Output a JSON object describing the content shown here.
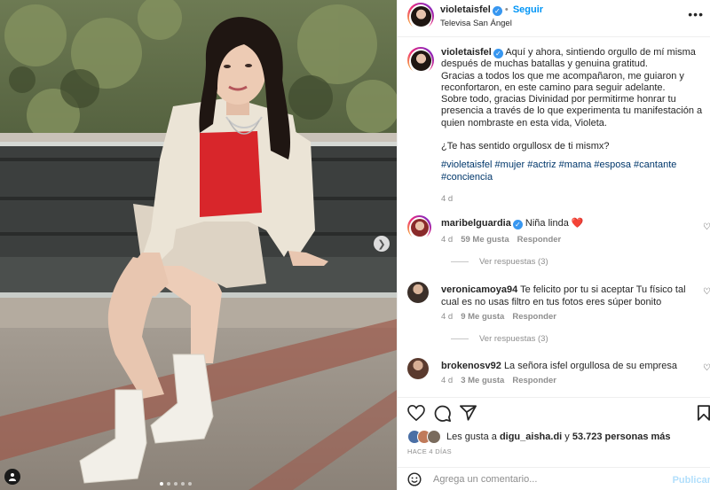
{
  "post": {
    "username": "violetaisfel",
    "follow_label": "Seguir",
    "location": "Televisa San Ángel",
    "more_label": "•••"
  },
  "caption": {
    "username": "violetaisfel",
    "lines": [
      "Aquí y ahora, sintiendo orgullo de mí misma después de muchas batallas y genuina gratitud.",
      "Gracias a todos los que me acompañaron, me guiaron y reconfortaron, en este camino para seguir adelante.",
      "Sobre todo, gracias Divinidad por permitirme honrar tu presencia a través de lo que experimenta tu manifestación a quien nombraste en esta vida, Violeta.",
      "",
      "¿Te has sentido orgullosx de ti mismx?"
    ],
    "hashtags": "#violetaisfel #mujer #actriz #mama #esposa #cantante #conciencia",
    "time": "4 d"
  },
  "comments": [
    {
      "username": "maribelguardia",
      "verified": true,
      "text": "Niña linda ❤️",
      "time": "4 d",
      "likes": "59 Me gusta",
      "reply_label": "Responder",
      "replies_label": "Ver respuestas (3)"
    },
    {
      "username": "veronicamoya94",
      "verified": false,
      "text": "Te felicito por tu si aceptar Tu físico tal cual es no usas filtro en tus fotos eres súper bonito",
      "time": "4 d",
      "likes": "9 Me gusta",
      "reply_label": "Responder",
      "replies_label": "Ver respuestas (3)"
    },
    {
      "username": "brokenosv92",
      "verified": false,
      "text": "La señora isfel orgullosa de su empresa",
      "time": "4 d",
      "likes": "3 Me gusta",
      "reply_label": "Responder",
      "replies_label": ""
    }
  ],
  "likes": {
    "prefix": "Les gusta a",
    "user": "digu_aisha.di",
    "middle": "y",
    "count": "53.723 personas más"
  },
  "posted_ago": "HACE 4 DÍAS",
  "add_comment": {
    "placeholder": "Agrega un comentario...",
    "publish_label": "Publicar"
  },
  "icons": {
    "like": "heart-icon",
    "comment": "comment-icon",
    "share": "share-icon",
    "save": "bookmark-icon",
    "emoji": "emoji-icon",
    "next": "chevron-right-icon",
    "tag": "user-tag-icon"
  },
  "colors": {
    "accent": "#0095f6",
    "hashtag": "#00376b",
    "muted": "#8e8e8e",
    "verified": "#3897f0"
  }
}
